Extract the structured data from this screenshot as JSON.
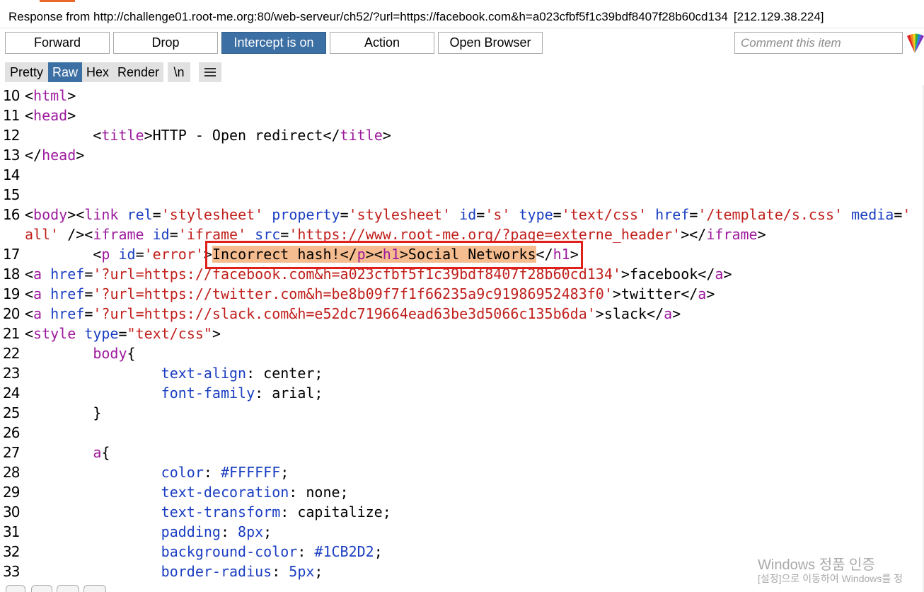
{
  "window": {
    "title": "Response from http://challenge01.root-me.org:80/web-serveur/ch52/?url=https://facebook.com&h=a023cfbf5f1c39bdf8407f28b60cd134",
    "ip": "[212.129.38.224]"
  },
  "toolbar": {
    "forward_label": "Forward",
    "drop_label": "Drop",
    "intercept_label": "Intercept is on",
    "action_label": "Action",
    "open_browser_label": "Open Browser",
    "comment_placeholder": "Comment this item"
  },
  "tabs": {
    "pretty": "Pretty",
    "raw": "Raw",
    "hex": "Hex",
    "render": "Render",
    "newline": "\\n"
  },
  "colors": {
    "accent": "#3c6fa3",
    "tag": "#9d1a9d",
    "attr": "#1a3ec2",
    "value": "#c0201c",
    "highlight": "#f5bd8f",
    "annotation_box": "#e0201a"
  },
  "code_lines": [
    {
      "n": "10",
      "segs": [
        [
          "p",
          "<"
        ],
        [
          "t",
          "html"
        ],
        [
          "p",
          ">"
        ]
      ]
    },
    {
      "n": "11",
      "segs": [
        [
          "p",
          "<"
        ],
        [
          "t",
          "head"
        ],
        [
          "p",
          ">"
        ]
      ]
    },
    {
      "n": "12",
      "segs": [
        [
          "p",
          "        <"
        ],
        [
          "t",
          "title"
        ],
        [
          "p",
          ">HTTP - Open redirect</"
        ],
        [
          "t",
          "title"
        ],
        [
          "p",
          ">"
        ]
      ]
    },
    {
      "n": "13",
      "segs": [
        [
          "p",
          "</"
        ],
        [
          "t",
          "head"
        ],
        [
          "p",
          ">"
        ]
      ]
    },
    {
      "n": "14",
      "segs": []
    },
    {
      "n": "15",
      "segs": []
    },
    {
      "n": "16",
      "segs": [
        [
          "p",
          "<"
        ],
        [
          "t",
          "body"
        ],
        [
          "p",
          "><"
        ],
        [
          "t",
          "link"
        ],
        [
          "p",
          " "
        ],
        [
          "a",
          "rel"
        ],
        [
          "p",
          "="
        ],
        [
          "v",
          "'stylesheet'"
        ],
        [
          "p",
          " "
        ],
        [
          "a",
          "property"
        ],
        [
          "p",
          "="
        ],
        [
          "v",
          "'stylesheet'"
        ],
        [
          "p",
          " "
        ],
        [
          "a",
          "id"
        ],
        [
          "p",
          "="
        ],
        [
          "v",
          "'s'"
        ],
        [
          "p",
          " "
        ],
        [
          "a",
          "type"
        ],
        [
          "p",
          "="
        ],
        [
          "v",
          "'text/css'"
        ],
        [
          "p",
          " "
        ],
        [
          "a",
          "href"
        ],
        [
          "p",
          "="
        ],
        [
          "v",
          "'/template/s.css'"
        ],
        [
          "p",
          " "
        ],
        [
          "a",
          "media"
        ],
        [
          "p",
          "="
        ],
        [
          "v",
          "'"
        ]
      ]
    },
    {
      "n": "",
      "segs": [
        [
          "v",
          "all'"
        ],
        [
          "p",
          " /><"
        ],
        [
          "t",
          "iframe"
        ],
        [
          "p",
          " "
        ],
        [
          "a",
          "id"
        ],
        [
          "p",
          "="
        ],
        [
          "v",
          "'iframe'"
        ],
        [
          "p",
          " "
        ],
        [
          "a",
          "src"
        ],
        [
          "p",
          "="
        ],
        [
          "v",
          "'https://www.root-me.org/?page=externe_header'"
        ],
        [
          "p",
          "></"
        ],
        [
          "t",
          "iframe"
        ],
        [
          "p",
          ">"
        ]
      ]
    },
    {
      "n": "17",
      "segs": [
        [
          "p",
          "        <"
        ],
        [
          "t",
          "p"
        ],
        [
          "p",
          " "
        ],
        [
          "a",
          "id"
        ],
        [
          "p",
          "="
        ],
        [
          "v",
          "'error'"
        ],
        [
          "p",
          ">"
        ],
        [
          "h",
          "Incorrect hash!</"
        ],
        [
          "ht",
          "p"
        ],
        [
          "h",
          "><"
        ],
        [
          "ht",
          "h1"
        ],
        [
          "h",
          ">Social Networks"
        ],
        [
          "p",
          "</"
        ],
        [
          "t",
          "h1"
        ],
        [
          "p",
          ">"
        ]
      ]
    },
    {
      "n": "18",
      "segs": [
        [
          "p",
          "<"
        ],
        [
          "t",
          "a"
        ],
        [
          "p",
          " "
        ],
        [
          "a",
          "href"
        ],
        [
          "p",
          "="
        ],
        [
          "v",
          "'?url=https://facebook.com&h=a023cfbf5f1c39bdf8407f28b60cd134'"
        ],
        [
          "p",
          ">facebook</"
        ],
        [
          "t",
          "a"
        ],
        [
          "p",
          ">"
        ]
      ]
    },
    {
      "n": "19",
      "segs": [
        [
          "p",
          "<"
        ],
        [
          "t",
          "a"
        ],
        [
          "p",
          " "
        ],
        [
          "a",
          "href"
        ],
        [
          "p",
          "="
        ],
        [
          "v",
          "'?url=https://twitter.com&h=be8b09f7f1f66235a9c91986952483f0'"
        ],
        [
          "p",
          ">twitter</"
        ],
        [
          "t",
          "a"
        ],
        [
          "p",
          ">"
        ]
      ]
    },
    {
      "n": "20",
      "segs": [
        [
          "p",
          "<"
        ],
        [
          "t",
          "a"
        ],
        [
          "p",
          " "
        ],
        [
          "a",
          "href"
        ],
        [
          "p",
          "="
        ],
        [
          "v",
          "'?url=https://slack.com&h=e52dc719664ead63be3d5066c135b6da'"
        ],
        [
          "p",
          ">slack</"
        ],
        [
          "t",
          "a"
        ],
        [
          "p",
          ">"
        ]
      ]
    },
    {
      "n": "21",
      "segs": [
        [
          "p",
          "<"
        ],
        [
          "t",
          "style"
        ],
        [
          "p",
          " "
        ],
        [
          "a",
          "type"
        ],
        [
          "p",
          "="
        ],
        [
          "v",
          "\"text/css\""
        ],
        [
          "p",
          ">"
        ]
      ]
    },
    {
      "n": "22",
      "segs": [
        [
          "p",
          "        "
        ],
        [
          "t",
          "body"
        ],
        [
          "p",
          "{"
        ]
      ]
    },
    {
      "n": "23",
      "segs": [
        [
          "p",
          "                "
        ],
        [
          "a",
          "text-align"
        ],
        [
          "p",
          ": center;"
        ]
      ]
    },
    {
      "n": "24",
      "segs": [
        [
          "p",
          "                "
        ],
        [
          "a",
          "font-family"
        ],
        [
          "p",
          ": arial;"
        ]
      ]
    },
    {
      "n": "25",
      "segs": [
        [
          "p",
          "        }"
        ]
      ]
    },
    {
      "n": "26",
      "segs": []
    },
    {
      "n": "27",
      "segs": [
        [
          "p",
          "        "
        ],
        [
          "t",
          "a"
        ],
        [
          "p",
          "{"
        ]
      ]
    },
    {
      "n": "28",
      "segs": [
        [
          "p",
          "                "
        ],
        [
          "a",
          "color"
        ],
        [
          "p",
          ": "
        ],
        [
          "a",
          "#FFFFFF"
        ],
        [
          "p",
          ";"
        ]
      ]
    },
    {
      "n": "29",
      "segs": [
        [
          "p",
          "                "
        ],
        [
          "a",
          "text-decoration"
        ],
        [
          "p",
          ": none;"
        ]
      ]
    },
    {
      "n": "30",
      "segs": [
        [
          "p",
          "                "
        ],
        [
          "a",
          "text-transform"
        ],
        [
          "p",
          ": capitalize;"
        ]
      ]
    },
    {
      "n": "31",
      "segs": [
        [
          "p",
          "                "
        ],
        [
          "a",
          "padding"
        ],
        [
          "p",
          ": "
        ],
        [
          "a",
          "8px"
        ],
        [
          "p",
          ";"
        ]
      ]
    },
    {
      "n": "32",
      "segs": [
        [
          "p",
          "                "
        ],
        [
          "a",
          "background-color"
        ],
        [
          "p",
          ": "
        ],
        [
          "a",
          "#1CB2D2"
        ],
        [
          "p",
          ";"
        ]
      ]
    },
    {
      "n": "33",
      "segs": [
        [
          "p",
          "                "
        ],
        [
          "a",
          "border-radius"
        ],
        [
          "p",
          ": "
        ],
        [
          "a",
          "5px"
        ],
        [
          "p",
          ";"
        ]
      ]
    }
  ],
  "watermark": {
    "line1": "Windows 정품 인증",
    "line2": "[설정]으로 이동하여 Windows를 정"
  }
}
